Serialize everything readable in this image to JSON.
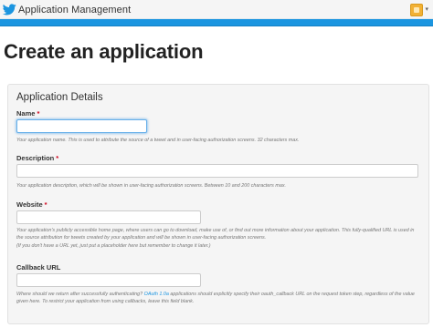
{
  "topbar": {
    "app_title": "Application Management",
    "logo_icon": "twitter-bird-icon",
    "avatar_icon": "user-avatar-icon",
    "caret_glyph": "▾"
  },
  "colors": {
    "brand_blue": "#1b95e0",
    "required_red": "#d0021b",
    "link_blue": "#1b95e0"
  },
  "page": {
    "title": "Create an application"
  },
  "panel": {
    "title": "Application Details"
  },
  "fields": {
    "name": {
      "label": "Name",
      "required_mark": "*",
      "value": "",
      "placeholder": "",
      "help": "Your application name. This is used to attribute the source of a tweet and in user-facing authorization screens. 32 characters max."
    },
    "description": {
      "label": "Description",
      "required_mark": "*",
      "value": "",
      "placeholder": "",
      "help": "Your application description, which will be shown in user-facing authorization screens. Between 10 and 200 characters max."
    },
    "website": {
      "label": "Website",
      "required_mark": "*",
      "value": "",
      "placeholder": "",
      "help_line1": "Your application's publicly accessible home page, where users can go to download, make use of, or find out more information about your application. This fully-qualified URL is used in the source attribution for tweets created by your application and will be shown in user-facing authorization screens.",
      "help_line2": "(If you don't have a URL yet, just put a placeholder here but remember to change it later.)"
    },
    "callback": {
      "label": "Callback URL",
      "value": "",
      "placeholder": "",
      "help_before": "Where should we return after successfully authenticating?",
      "help_link": "OAuth 1.0a",
      "help_after": "applications should explicitly specify their oauth_callback URL on the request token step, regardless of the value given here. To restrict your application from using callbacks, leave this field blank."
    }
  }
}
